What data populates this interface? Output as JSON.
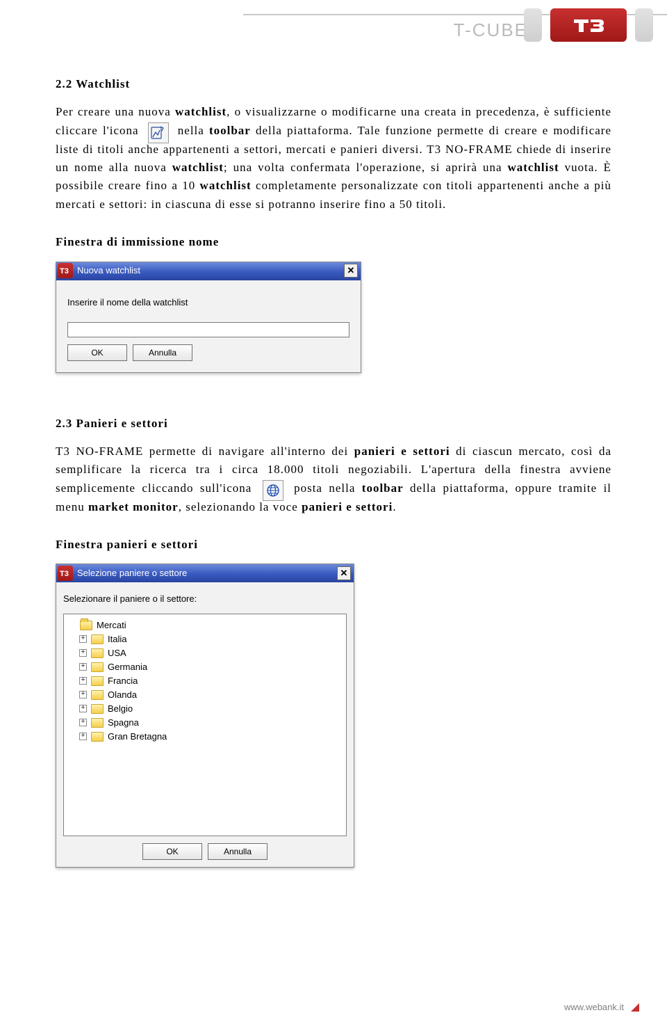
{
  "brand": {
    "text": "T-CUBE"
  },
  "section22_heading": "2.2   Watchlist",
  "p1a": "Per creare una nuova ",
  "p1b": "watchlist",
  "p1c": ", o visualizzarne o modificarne una creata in precedenza, è sufficiente cliccare l'icona ",
  "p1d": " nella ",
  "p1e": "toolbar",
  "p1f": " della piattaforma. Tale funzione permette di creare e modificare liste di titoli anche appartenenti a settori, mercati e panieri diversi. T3 NO-FRAME chiede di inserire un nome alla nuova ",
  "p1g": "watchlist",
  "p1h": "; una volta confermata l'operazione, si aprirà una ",
  "p1i": "watchlist",
  "p1j": " vuota. È possibile creare fino a 10 ",
  "p1k": "watchlist",
  "p1l": " completamente personalizzate con titoli appartenenti anche a più mercati e settori: in ciascuna di esse si potranno inserire fino a 50 titoli.",
  "label_window1": "Finestra di immissione nome",
  "dlg1": {
    "title": "Nuova watchlist",
    "prompt": "Inserire il nome della watchlist",
    "ok": "OK",
    "cancel": "Annulla"
  },
  "section23_heading": "2.3 Panieri e settori",
  "p2a": "T3 NO-FRAME permette di navigare all'interno dei ",
  "p2b": "panieri e settori",
  "p2c": " di ciascun mercato, così da semplificare la ricerca tra i circa 18.000 titoli negoziabili. L'apertura della finestra avviene semplicemente cliccando sull'icona ",
  "p2d": " posta nella ",
  "p2e": "toolbar",
  "p2f": " della piattaforma, oppure tramite il menu ",
  "p2g": "market monitor",
  "p2h": ", selezionando la voce ",
  "p2i": "panieri e settori",
  "p2j": ".",
  "label_window2": "Finestra panieri e settori",
  "dlg2": {
    "title": "Selezione paniere o settore",
    "prompt": "Selezionare il paniere o il settore:",
    "root": "Mercati",
    "items": [
      "Italia",
      "USA",
      "Germania",
      "Francia",
      "Olanda",
      "Belgio",
      "Spagna",
      "Gran Bretagna"
    ],
    "ok": "OK",
    "cancel": "Annulla"
  },
  "footer_url": "www.webank.it"
}
